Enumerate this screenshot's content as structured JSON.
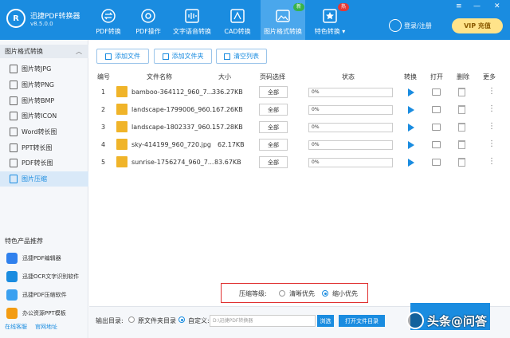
{
  "app": {
    "name": "迅捷PDF转换器",
    "version": "v8.5.0.0",
    "logo_letter": "R"
  },
  "colors": {
    "primary": "#1a8ce0",
    "active_tab": "#4aa7ec",
    "vip_bg": "#ffe38a",
    "highlight_border": "#e03030"
  },
  "nav": [
    {
      "label": "PDF转换",
      "icon": "swap-icon"
    },
    {
      "label": "PDF操作",
      "icon": "settings-icon"
    },
    {
      "label": "文字语音转换",
      "icon": "audio-icon"
    },
    {
      "label": "CAD转换",
      "icon": "cad-icon"
    },
    {
      "label": "图片格式转换",
      "icon": "image-icon",
      "active": true,
      "badge": "新"
    },
    {
      "label": "特色转换 ▾",
      "icon": "star-icon",
      "badge": "热"
    }
  ],
  "header": {
    "login": "登录/注册",
    "vip": "VIP 充值"
  },
  "window_controls": {
    "menu": "≡",
    "minimize": "—",
    "close": "✕"
  },
  "sidebar": {
    "section_title": "图片格式转换",
    "items": [
      "图片转JPG",
      "图片转PNG",
      "图片转BMP",
      "图片转ICON",
      "Word转长图",
      "PPT转长图",
      "PDF转长图",
      "图片压缩"
    ],
    "active_index": 7,
    "featured_title": "特色产品推荐",
    "featured": [
      "迅捷PDF编辑器",
      "迅捷OCR文字识别软件",
      "迅捷PDF压缩软件",
      "办公资源PPT模板"
    ],
    "footer": [
      "在线客服",
      "官网地址"
    ]
  },
  "toolbar": {
    "add_file": "添加文件",
    "add_folder": "添加文件夹",
    "clear_list": "清空列表"
  },
  "table": {
    "headers": {
      "index": "编号",
      "name": "文件名称",
      "size": "大小",
      "pages": "页码选择",
      "status": "状态",
      "convert": "转换",
      "open": "打开",
      "delete": "删除",
      "more": "更多"
    },
    "rows": [
      {
        "index": "1",
        "name": "bamboo-364112_960_7...",
        "size": "336.27KB",
        "pages": "全部",
        "progress": "0%"
      },
      {
        "index": "2",
        "name": "landscape-1799006_960...",
        "size": "167.26KB",
        "pages": "全部",
        "progress": "0%"
      },
      {
        "index": "3",
        "name": "landscape-1802337_960...",
        "size": "157.28KB",
        "pages": "全部",
        "progress": "0%"
      },
      {
        "index": "4",
        "name": "sky-414199_960_720.jpg",
        "size": "62.17KB",
        "pages": "全部",
        "progress": "0%"
      },
      {
        "index": "5",
        "name": "sunrise-1756274_960_7...",
        "size": "83.67KB",
        "pages": "全部",
        "progress": "0%"
      }
    ]
  },
  "compression": {
    "label": "压缩等级:",
    "option_clear": "清晰优先",
    "option_small": "缩小优先",
    "selected": "option_small"
  },
  "output": {
    "label": "输出目录:",
    "original": "原文件夹目录",
    "custom": "自定义:",
    "path": "D:\\迅捷PDF转换器",
    "browse": "浏选",
    "open_dir": "打开文件目录"
  },
  "watermark": "头条@问答"
}
